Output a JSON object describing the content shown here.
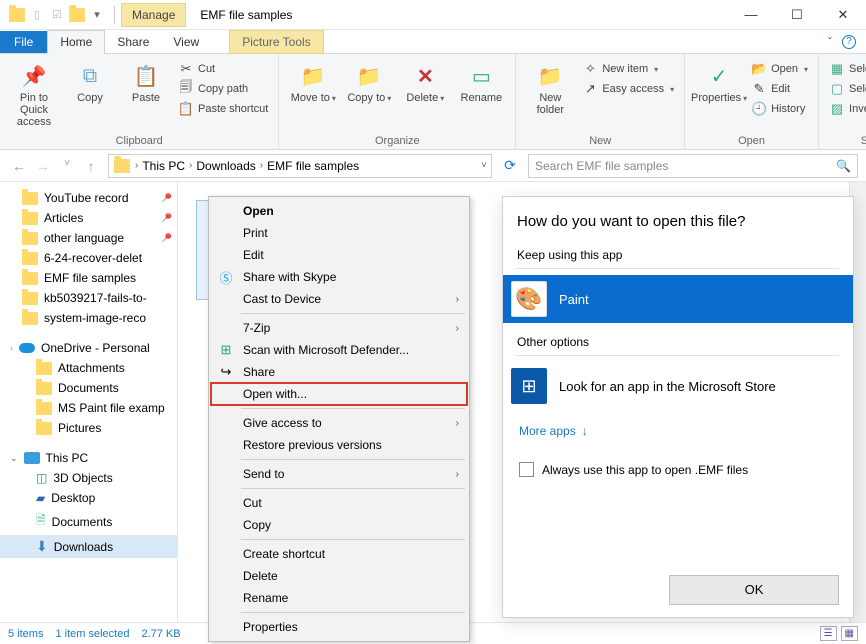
{
  "titlebar": {
    "manage_tab": "Manage",
    "window_title": "EMF file samples"
  },
  "tabs": {
    "file": "File",
    "home": "Home",
    "share": "Share",
    "view": "View",
    "picture_tools": "Picture Tools"
  },
  "ribbon": {
    "pin_quick": "Pin to Quick access",
    "copy": "Copy",
    "paste": "Paste",
    "cut": "Cut",
    "copy_path": "Copy path",
    "paste_shortcut": "Paste shortcut",
    "clipboard_group": "Clipboard",
    "move_to": "Move to",
    "copy_to": "Copy to",
    "delete": "Delete",
    "rename": "Rename",
    "organize_group": "Organize",
    "new_folder": "New folder",
    "new_item": "New item",
    "easy_access": "Easy access",
    "new_group": "New",
    "properties": "Properties",
    "open": "Open",
    "edit": "Edit",
    "history": "History",
    "open_group": "Open",
    "select_all": "Select all",
    "select_none": "Select none",
    "invert_selection": "Invert selection",
    "select_group": "Select"
  },
  "breadcrumb": {
    "items": [
      "This PC",
      "Downloads",
      "EMF file samples"
    ]
  },
  "search": {
    "placeholder": "Search EMF file samples"
  },
  "sidebar": {
    "quick": [
      "YouTube record",
      "Articles",
      "other language",
      "6-24-recover-delet",
      "EMF file samples",
      "kb5039217-fails-to-",
      "system-image-reco"
    ],
    "onedrive": "OneDrive - Personal",
    "onedrive_children": [
      "Attachments",
      "Documents",
      "MS Paint file examp",
      "Pictures"
    ],
    "thispc": "This PC",
    "thispc_children": [
      "3D Objects",
      "Desktop",
      "Documents",
      "Downloads"
    ]
  },
  "context_menu": {
    "open": "Open",
    "print": "Print",
    "edit": "Edit",
    "share_skype": "Share with Skype",
    "cast": "Cast to Device",
    "sevenzip": "7-Zip",
    "defender": "Scan with Microsoft Defender...",
    "share": "Share",
    "open_with": "Open with...",
    "give_access": "Give access to",
    "restore": "Restore previous versions",
    "send_to": "Send to",
    "cut": "Cut",
    "copy": "Copy",
    "create_shortcut": "Create shortcut",
    "delete": "Delete",
    "rename": "Rename",
    "properties": "Properties"
  },
  "dialog": {
    "heading": "How do you want to open this file?",
    "keep_using": "Keep using this app",
    "paint": "Paint",
    "other_options": "Other options",
    "store": "Look for an app in the Microsoft Store",
    "more_apps": "More apps",
    "always_use": "Always use this app to open .EMF files",
    "ok": "OK"
  },
  "status": {
    "count": "5 items",
    "selected": "1 item selected",
    "size": "2.77 KB"
  }
}
